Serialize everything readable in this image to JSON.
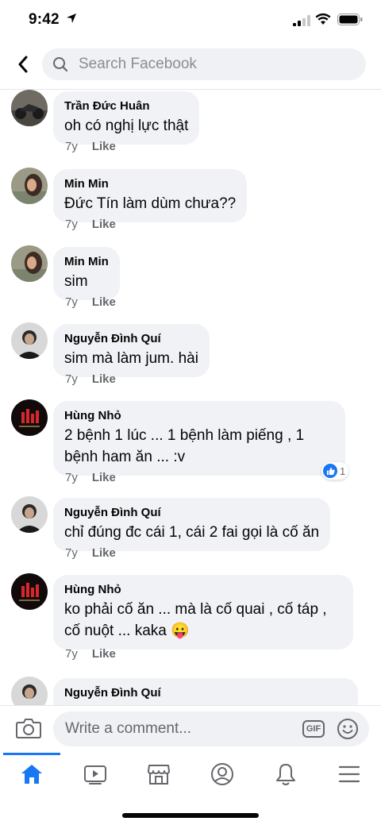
{
  "status_bar": {
    "time": "9:42"
  },
  "search": {
    "placeholder": "Search Facebook"
  },
  "comments": [
    {
      "author": "Trần Đức Huân",
      "text": "oh có nghị lực thật",
      "age": "7y",
      "like_label": "Like"
    },
    {
      "author": "Min Min",
      "text": "Đức Tín làm dùm chưa??",
      "age": "7y",
      "like_label": "Like"
    },
    {
      "author": "Min Min",
      "text": "sim",
      "age": "7y",
      "like_label": "Like"
    },
    {
      "author": "Nguyễn Đình Quí",
      "text": "sim mà làm jum. hài",
      "age": "7y",
      "like_label": "Like"
    },
    {
      "author": "Hùng Nhỏ",
      "text": "2 bệnh 1 lúc ... 1 bệnh làm piếng , 1 bệnh ham ăn ... :v",
      "age": "7y",
      "like_label": "Like",
      "reaction_count": "1"
    },
    {
      "author": "Nguyễn Đình Quí",
      "text": "chỉ đúng đc cái 1, cái 2 fai gọi là cố ăn",
      "age": "7y",
      "like_label": "Like"
    },
    {
      "author": "Hùng Nhỏ",
      "text": "ko phải cố ăn ... mà là cố quai , cố táp , cố nuột ... kaka 😛",
      "age": "7y",
      "like_label": "Like"
    },
    {
      "author": "Nguyễn Đình Quí",
      "text": "",
      "age": "",
      "like_label": ""
    }
  ],
  "composer": {
    "placeholder": "Write a comment...",
    "gif_label": "GIF"
  },
  "colors": {
    "accent": "#1877f2",
    "bubble": "#f0f2f5",
    "muted": "#65676b"
  }
}
